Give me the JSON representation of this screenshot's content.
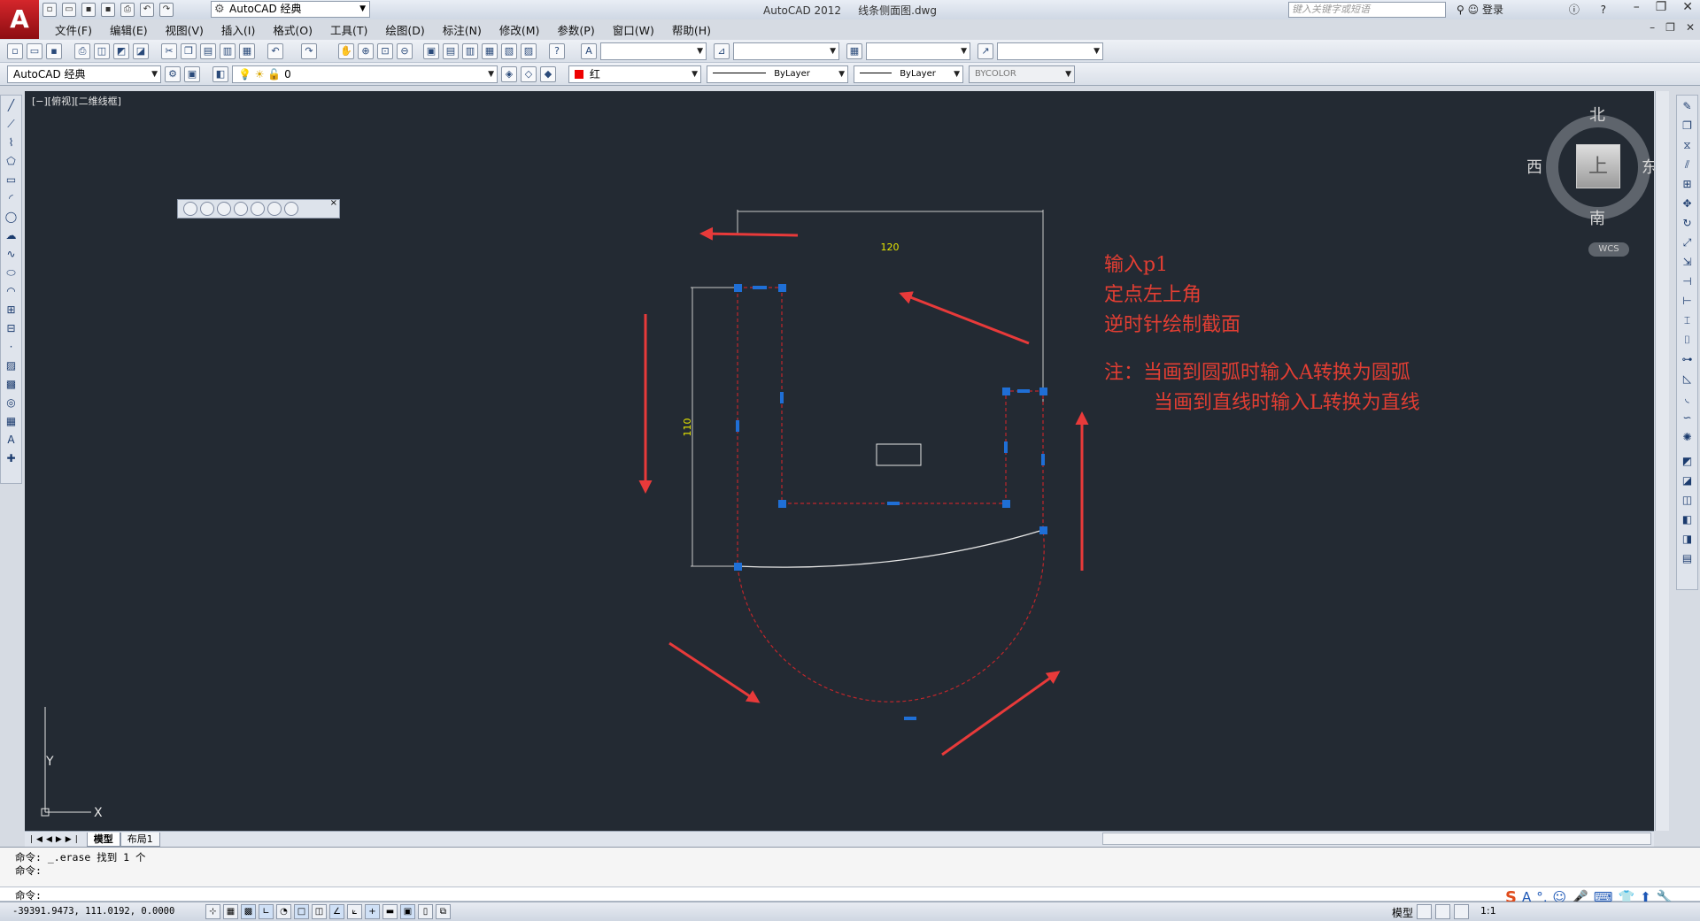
{
  "app": {
    "title": "AutoCAD 2012",
    "file": "线条侧面图.dwg",
    "logo": "A"
  },
  "workspace": {
    "label": "AutoCAD 经典"
  },
  "search": {
    "placeholder": "键入关键字或短语"
  },
  "login": {
    "label": "登录"
  },
  "menu": [
    "文件(F)",
    "编辑(E)",
    "视图(V)",
    "插入(I)",
    "格式(O)",
    "工具(T)",
    "绘图(D)",
    "标注(N)",
    "修改(M)",
    "参数(P)",
    "窗口(W)",
    "帮助(H)"
  ],
  "toolbar2": {
    "workspace_combo": "AutoCAD 经典",
    "layer_combo": "0",
    "color_combo": "红",
    "linetype_combo": "ByLayer",
    "lineweight_combo": "ByLayer",
    "plotstyle_combo": "BYCOLOR"
  },
  "viewport": {
    "label": "[−][俯视][二维线框]",
    "dim_width": "120",
    "dim_height": "110",
    "ucs_x": "X",
    "ucs_y": "Y",
    "colors": {
      "background": "#232a33",
      "grip": "#1f6fd6",
      "dashed": "#c0262b",
      "arrow": "#e83a3a",
      "dimtext": "#e6e600"
    }
  },
  "annotation": {
    "line1": "输入p1",
    "line2": "定点左上角",
    "line3": "逆时针绘制截面",
    "note1": "注：当画到圆弧时输入A转换为圆弧",
    "note2": "当画到直线时输入L转换为直线"
  },
  "viewcube": {
    "north": "北",
    "south": "南",
    "east": "东",
    "west": "西",
    "face": "上",
    "wcs": "WCS"
  },
  "tabs": [
    "模型",
    "布局1"
  ],
  "command": {
    "line1": "命令: _.erase 找到 1 个",
    "line2": "命令:",
    "prompt": "命令:"
  },
  "status": {
    "coords": "-39391.9473, 111.0192, 0.0000",
    "model": "模型",
    "scale": "1:1"
  }
}
